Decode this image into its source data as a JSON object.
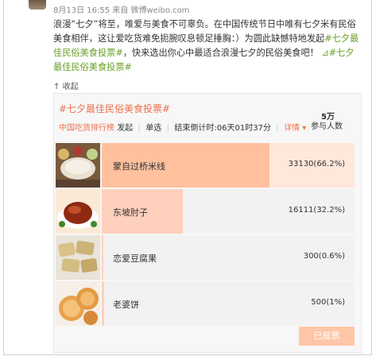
{
  "post": {
    "meta": "8月13日 16:55 来自 微博weibo.com",
    "text_part1": "浪漫“七夕”将至，唯爱与美食不可辜负。在中国传统节日中唯有七夕米有民俗美食相伴，这让爱吃货难免扼腕叹息顿足捶胸：）为圆此缺憾特地发起",
    "hashtag1": "#七夕最佳民俗美食投票#",
    "text_part2": "，快来选出你心中最适合浪漫七夕的民俗美食吧！",
    "hashtag2": "#七夕最佳民俗美食投票#",
    "collapse_label": "收起"
  },
  "poll": {
    "title": "#七夕最佳民俗美食投票#",
    "participants_value": "5万",
    "participants_label": "参与人数",
    "publisher": "中国吃货排行榜",
    "publisher_suffix": "发起",
    "mode": "单选",
    "deadline": "结束倒计时:06天01时37分",
    "details_link": "详情",
    "voted_button": "已投票",
    "options": [
      {
        "name": "蒙自过桥米线",
        "count": "33130(66.2%)",
        "percent": 66.2,
        "image": "rice-noodles-icon"
      },
      {
        "name": "东坡肘子",
        "count": "16111(32.2%)",
        "percent": 32.2,
        "image": "braised-pork-icon"
      },
      {
        "name": "恋爱豆腐果",
        "count": "300(0.6%)",
        "percent": 0.6,
        "image": "tofu-icon"
      },
      {
        "name": "老婆饼",
        "count": "500(1%)",
        "percent": 1,
        "image": "wife-cake-icon"
      }
    ]
  },
  "colors": {
    "accent": "#eb7350",
    "hashtag": "#6aa12c",
    "bar_fill_top": "#ffc09e",
    "bar_fill": "#ffd0bc"
  }
}
